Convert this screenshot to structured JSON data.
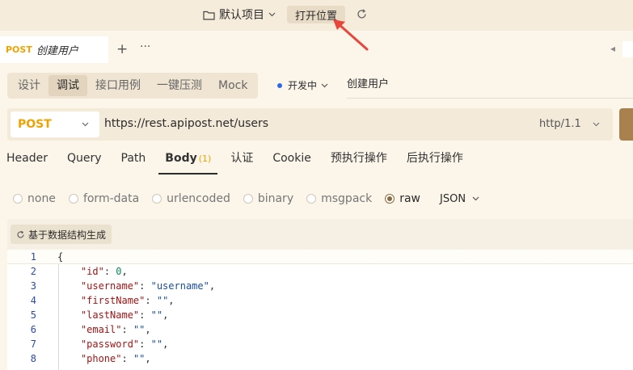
{
  "topbar": {
    "project_name": "默认项目",
    "open_location_label": "打开位置"
  },
  "tabs": {
    "active": {
      "method": "POST",
      "name": "创建用户"
    },
    "add_label": "+",
    "more_label": "···"
  },
  "modes": [
    {
      "label": "设计",
      "active": false
    },
    {
      "label": "调试",
      "active": true
    },
    {
      "label": "接口用例",
      "active": false
    },
    {
      "label": "一键压测",
      "active": false
    },
    {
      "label": "Mock",
      "active": false
    }
  ],
  "status": {
    "label": "开发中",
    "color": "#2d67f0"
  },
  "api_name": "创建用户",
  "request": {
    "method": "POST",
    "url": "https://rest.apipost.net/users",
    "http_version": "http/1.1"
  },
  "request_tabs": [
    {
      "label": "Header",
      "badge": "",
      "active": false
    },
    {
      "label": "Query",
      "badge": "",
      "active": false
    },
    {
      "label": "Path",
      "badge": "",
      "active": false
    },
    {
      "label": "Body",
      "badge": "(1)",
      "active": true
    },
    {
      "label": "认证",
      "badge": "",
      "active": false
    },
    {
      "label": "Cookie",
      "badge": "",
      "active": false
    },
    {
      "label": "预执行操作",
      "badge": "",
      "active": false
    },
    {
      "label": "后执行操作",
      "badge": "",
      "active": false
    }
  ],
  "body_types": [
    {
      "label": "none",
      "selected": false
    },
    {
      "label": "form-data",
      "selected": false
    },
    {
      "label": "urlencoded",
      "selected": false
    },
    {
      "label": "binary",
      "selected": false
    },
    {
      "label": "msgpack",
      "selected": false
    },
    {
      "label": "raw",
      "selected": true
    }
  ],
  "raw_format": "JSON",
  "generate_button_label": "基于数据结构生成",
  "code_lines": [
    {
      "num": "1",
      "key": "",
      "value": "",
      "raw": "{"
    },
    {
      "num": "2",
      "key": "\"id\"",
      "value": "0",
      "type": "number"
    },
    {
      "num": "3",
      "key": "\"username\"",
      "value": "\"username\"",
      "type": "string"
    },
    {
      "num": "4",
      "key": "\"firstName\"",
      "value": "\"\"",
      "type": "string"
    },
    {
      "num": "5",
      "key": "\"lastName\"",
      "value": "\"\"",
      "type": "string"
    },
    {
      "num": "6",
      "key": "\"email\"",
      "value": "\"\"",
      "type": "string"
    },
    {
      "num": "7",
      "key": "\"password\"",
      "value": "\"\"",
      "type": "string"
    },
    {
      "num": "8",
      "key": "\"phone\"",
      "value": "\"\"",
      "type": "string"
    }
  ],
  "colors": {
    "accent_method": "#f0a300",
    "send_button": "#a8814f",
    "status_dot": "#2d67f0",
    "annotation_arrow": "#e8463a"
  }
}
